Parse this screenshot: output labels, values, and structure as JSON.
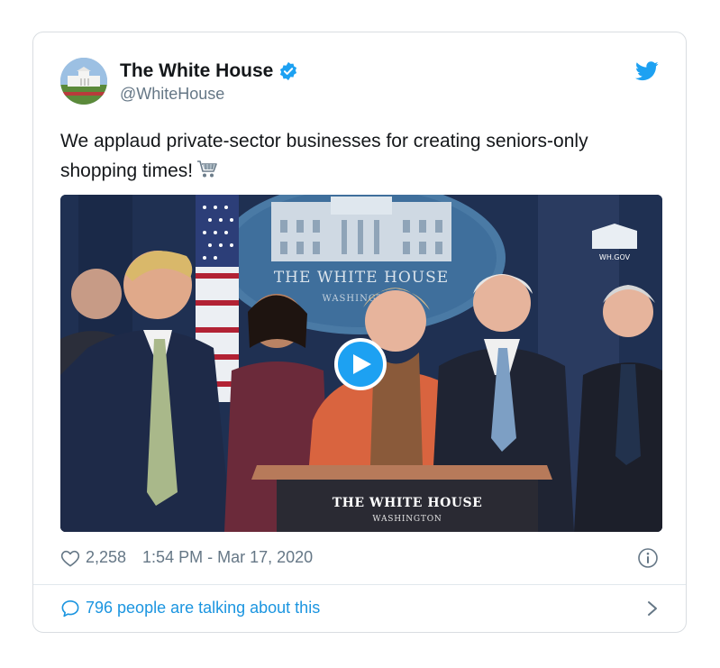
{
  "tweet": {
    "display_name": "The White House",
    "handle": "@WhiteHouse",
    "verified": true,
    "text": "We applaud private-sector businesses for creating seniors-only shopping times!",
    "text_emoji": "shopping-cart-emoji",
    "media": {
      "type": "video",
      "backdrop_text": "THE WHITE HOUSE",
      "backdrop_subtext": "WASHINGTON",
      "podium_title": "THE WHITE HOUSE",
      "podium_subtitle": "WASHINGTON",
      "watermark": "WH.GOV"
    },
    "likes": "2,258",
    "timestamp": "1:54 PM - Mar 17, 2020",
    "conversation": "796 people are talking about this"
  },
  "colors": {
    "accent": "#1da1f2",
    "link": "#1b95e0",
    "muted": "#657786",
    "border": "#d9dde1"
  },
  "icons": {
    "brand": "twitter-bird-icon",
    "verified": "verified-badge-icon",
    "like": "heart-icon",
    "info": "info-icon",
    "reply": "speech-bubble-icon",
    "more": "chevron-right-icon",
    "play": "play-icon"
  }
}
